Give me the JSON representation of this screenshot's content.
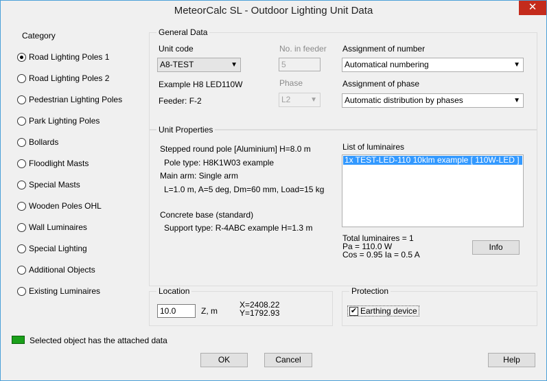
{
  "window": {
    "title": "MeteorCalc SL - Outdoor Lighting Unit Data",
    "close_glyph": "✕"
  },
  "category": {
    "label": "Category",
    "items": [
      {
        "label": "Road Lighting Poles 1",
        "selected": true
      },
      {
        "label": "Road Lighting Poles 2",
        "selected": false
      },
      {
        "label": "Pedestrian Lighting Poles",
        "selected": false
      },
      {
        "label": "Park Lighting Poles",
        "selected": false
      },
      {
        "label": "Bollards",
        "selected": false
      },
      {
        "label": "Floodlight Masts",
        "selected": false
      },
      {
        "label": "Special Masts",
        "selected": false
      },
      {
        "label": "Wooden Poles OHL",
        "selected": false
      },
      {
        "label": "Wall Luminaires",
        "selected": false
      },
      {
        "label": "Special Lighting",
        "selected": false
      },
      {
        "label": "Additional Objects",
        "selected": false
      },
      {
        "label": "Existing Luminaires",
        "selected": false
      }
    ]
  },
  "general": {
    "title": "General Data",
    "unit_code_label": "Unit code",
    "unit_code_value": "A8-TEST",
    "no_in_feeder_label": "No. in feeder",
    "no_in_feeder_value": "5",
    "example": "Example H8  LED110W",
    "phase_label": "Phase",
    "phase_value": "L2",
    "feeder": "Feeder: F-2",
    "assign_number_label": "Assignment of number",
    "assign_number_value": "Automatical numbering",
    "assign_phase_label": "Assignment of phase",
    "assign_phase_value": "Automatic distribution by phases"
  },
  "unit": {
    "title": "Unit Properties",
    "lines": [
      "Stepped  round  pole  [Aluminium]  H=8.0 m",
      "Pole type:  H8K1W03 example",
      "Main arm:  Single arm",
      "L=1.0 m,  A=5 deg,  Dm=60 mm,  Load=15 kg",
      "Concrete base (standard)",
      "Support type:  R-4ABC example  H=1.3 m"
    ],
    "list_label": "List of luminaires",
    "luminaires": [
      "1x TEST-LED-110 10klm example [ 110W-LED ]"
    ],
    "totals": [
      "Total luminaires = 1",
      "Pa = 110.0 W",
      "Cos = 0.95  Ia = 0.5 A"
    ],
    "info_button": "Info"
  },
  "location": {
    "title": "Location",
    "z_value": "10.0",
    "z_label": "Z, m",
    "x": "X=2408.22",
    "y": "Y=1792.93"
  },
  "protection": {
    "title": "Protection",
    "earthing_label": "Earthing device",
    "earthing_checked": true
  },
  "legend": {
    "text": "Selected object has the attached data",
    "color": "#1aa01a"
  },
  "buttons": {
    "ok": "OK",
    "cancel": "Cancel",
    "help": "Help"
  },
  "icons": {
    "dropdown": "chevron-down-icon",
    "check": "✔"
  }
}
